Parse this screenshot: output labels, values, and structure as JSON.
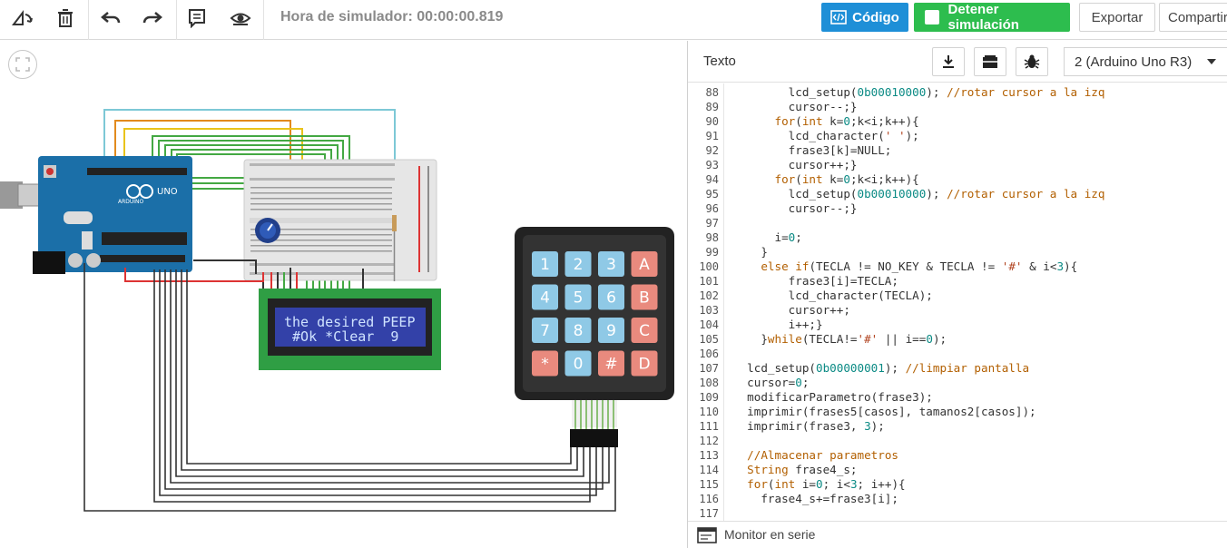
{
  "toolbar": {
    "sim_time": "Hora de simulador: 00:00:00.819",
    "code_label": "Código",
    "stop_label": "Detener simulación",
    "export_label": "Exportar",
    "share_label": "Compartir"
  },
  "lcd": {
    "line1": "the desired PEEP",
    "line2": " #Ok *Clear  9"
  },
  "keypad": {
    "keys": [
      "1",
      "2",
      "3",
      "A",
      "4",
      "5",
      "6",
      "B",
      "7",
      "8",
      "9",
      "C",
      "*",
      "0",
      "#",
      "D"
    ]
  },
  "arduino": {
    "brand": "ARDUINO",
    "model": "UNO"
  },
  "panel": {
    "title": "Texto",
    "device": "2 (Arduino Uno R3)",
    "monitor_label": "Monitor en serie"
  },
  "code_lines": [
    {
      "n": "88",
      "t": "        lcd_setup(0b00010000); //rotar cursor a la izq"
    },
    {
      "n": "89",
      "t": "        cursor--;}"
    },
    {
      "n": "90",
      "t": "      for(int k=0;k<i;k++){"
    },
    {
      "n": "91",
      "t": "        lcd_character(' ');"
    },
    {
      "n": "92",
      "t": "        frase3[k]=NULL;"
    },
    {
      "n": "93",
      "t": "        cursor++;}"
    },
    {
      "n": "94",
      "t": "      for(int k=0;k<i;k++){"
    },
    {
      "n": "95",
      "t": "        lcd_setup(0b00010000); //rotar cursor a la izq"
    },
    {
      "n": "96",
      "t": "        cursor--;}"
    },
    {
      "n": "97",
      "t": ""
    },
    {
      "n": "98",
      "t": "      i=0;"
    },
    {
      "n": "99",
      "t": "    }"
    },
    {
      "n": "100",
      "t": "    else if(TECLA != NO_KEY & TECLA != '#' & i<3){"
    },
    {
      "n": "101",
      "t": "        frase3[i]=TECLA;"
    },
    {
      "n": "102",
      "t": "        lcd_character(TECLA);"
    },
    {
      "n": "103",
      "t": "        cursor++;"
    },
    {
      "n": "104",
      "t": "        i++;}"
    },
    {
      "n": "105",
      "t": "    }while(TECLA!='#' || i==0);"
    },
    {
      "n": "106",
      "t": ""
    },
    {
      "n": "107",
      "t": "  lcd_setup(0b00000001); //limpiar pantalla"
    },
    {
      "n": "108",
      "t": "  cursor=0;"
    },
    {
      "n": "109",
      "t": "  modificarParametro(frase3);"
    },
    {
      "n": "110",
      "t": "  imprimir(frases5[casos], tamanos2[casos]);"
    },
    {
      "n": "111",
      "t": "  imprimir(frase3, 3);"
    },
    {
      "n": "112",
      "t": ""
    },
    {
      "n": "113",
      "t": "  //Almacenar parametros"
    },
    {
      "n": "114",
      "t": "  String frase4_s;"
    },
    {
      "n": "115",
      "t": "  for(int i=0; i<3; i++){"
    },
    {
      "n": "116",
      "t": "    frase4_s+=frase3[i];"
    },
    {
      "n": "117",
      "t": ""
    }
  ],
  "colors": {
    "code_button": "#1e8fd7",
    "stop_button": "#2dbd4e",
    "arduino_board": "#1b6fa8",
    "lcd_board": "#2f9e44",
    "lcd_screen": "#3341a8",
    "keypad_blue": "#8fc9e6",
    "keypad_red": "#e98a7e"
  }
}
